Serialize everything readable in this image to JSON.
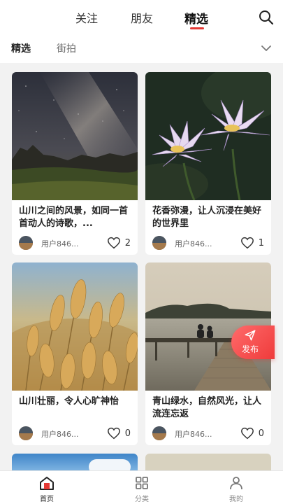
{
  "header": {
    "tabs": [
      {
        "label": "关注"
      },
      {
        "label": "朋友"
      },
      {
        "label": "精选"
      }
    ],
    "active_tab": "精选",
    "accent_color": "#e53935"
  },
  "sub_tabs": {
    "items": [
      {
        "label": "精选"
      },
      {
        "label": "街拍"
      }
    ],
    "active": "精选"
  },
  "cards": [
    {
      "title": "山川之间的风景，如同一首首动人的诗歌，...",
      "author": "用户846...",
      "likes": "2",
      "image": "milky-way-mountains"
    },
    {
      "title": "花香弥漫，让人沉浸在美好的世界里",
      "author": "用户846...",
      "likes": "1",
      "image": "water-lilies"
    },
    {
      "title": "山川壮丽，令人心旷神怡",
      "author": "用户846...",
      "likes": "0",
      "image": "wheat-field"
    },
    {
      "title": "青山绿水，自然风光，让人流连忘返",
      "author": "用户846...",
      "likes": "0",
      "image": "lake-pier"
    }
  ],
  "publish_button": {
    "label": "发布"
  },
  "bottom_nav": {
    "items": [
      {
        "label": "首页",
        "icon": "home-icon"
      },
      {
        "label": "分类",
        "icon": "grid-icon"
      },
      {
        "label": "我的",
        "icon": "user-icon"
      }
    ],
    "active": "首页"
  }
}
